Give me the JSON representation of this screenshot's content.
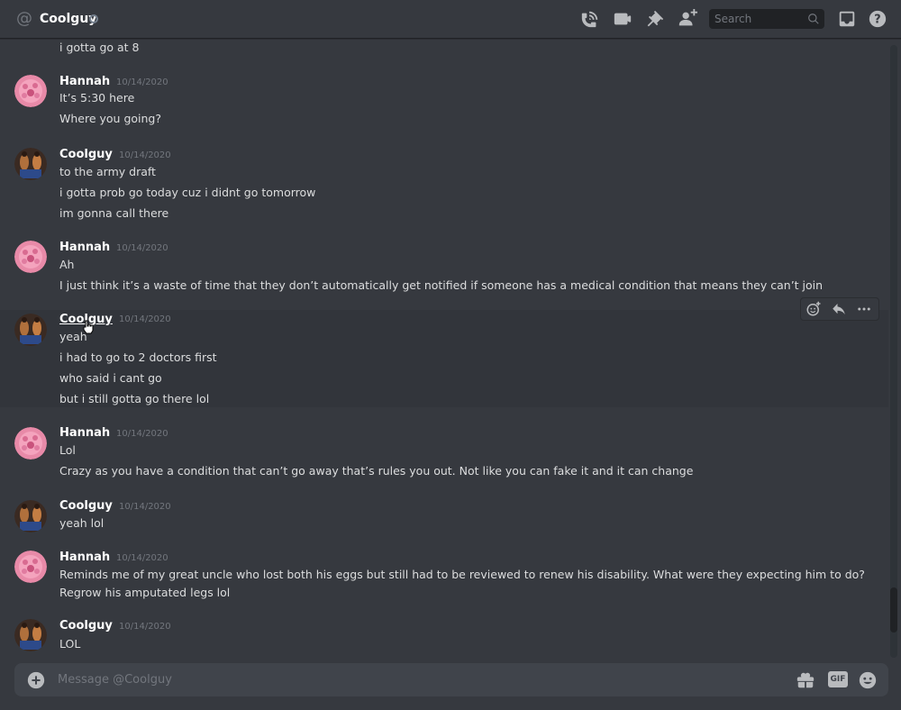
{
  "header": {
    "dm_name": "Coolguy",
    "search_placeholder": "Search"
  },
  "messages": [
    {
      "author": "",
      "timestamp": "",
      "lines": [
        "i gotta go at 8"
      ]
    },
    {
      "author": "Hannah",
      "timestamp": "10/14/2020",
      "lines": [
        "It’s 5:30 here",
        "Where you going?"
      ]
    },
    {
      "author": "Coolguy",
      "timestamp": "10/14/2020",
      "lines": [
        "to the army draft",
        "i gotta prob go today cuz i didnt go tomorrow",
        "im gonna call there"
      ]
    },
    {
      "author": "Hannah",
      "timestamp": "10/14/2020",
      "lines": [
        "Ah",
        "I just think it’s a waste of time that they don’t automatically get notified if someone has a medical condition that means they can’t join"
      ]
    },
    {
      "author": "Coolguy",
      "timestamp": "10/14/2020",
      "lines": [
        "yeah",
        "i had to go to 2 doctors first",
        "who said i cant go",
        "but i still gotta go there lol"
      ]
    },
    {
      "author": "Hannah",
      "timestamp": "10/14/2020",
      "lines": [
        "Lol",
        "Crazy as you have a condition that can’t go away that’s rules you out.  Not like you can fake it and it can change"
      ]
    },
    {
      "author": "Coolguy",
      "timestamp": "10/14/2020",
      "lines": [
        "yeah lol"
      ]
    },
    {
      "author": "Hannah",
      "timestamp": "10/14/2020",
      "lines": [
        "Reminds me of my great uncle who lost both his eggs but still had to be reviewed to renew his disability.  What were they expecting him to do?",
        "Regrow his amputated legs lol"
      ]
    },
    {
      "author": "Coolguy",
      "timestamp": "10/14/2020",
      "lines": [
        "LOL"
      ]
    }
  ],
  "composer": {
    "placeholder": "Message @Coolguy",
    "gif_label": "GIF"
  },
  "colors": {
    "background": "#36393f",
    "text": "#dcddde",
    "muted": "#72767d",
    "composer_bg": "#40444b"
  }
}
